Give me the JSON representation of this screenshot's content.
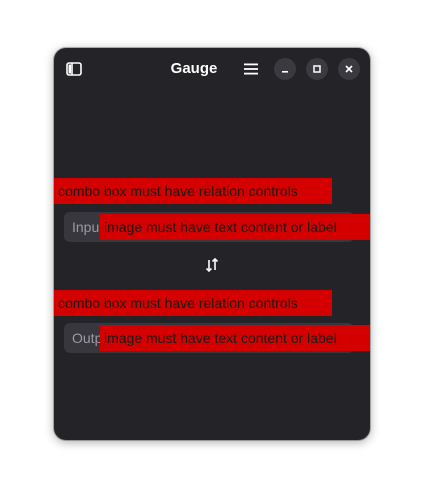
{
  "window": {
    "title": "Gauge"
  },
  "titlebar": {
    "sidebar_icon": "sidebar-toggle-icon",
    "menu_icon": "hamburger-menu-icon",
    "minimize_icon": "minimize-icon",
    "maximize_icon": "maximize-icon",
    "close_icon": "close-icon"
  },
  "input_section": {
    "combo_error": "combo box must have relation controls",
    "field_value": "Inpu",
    "image_error": "image must have text content or label"
  },
  "swap": {
    "icon": "swap-vertical-arrows-icon"
  },
  "output_section": {
    "combo_error": "combo box must have relation controls",
    "field_value": "Outp",
    "image_error": "image must have text content or label"
  },
  "colors": {
    "window_bg": "#232328",
    "field_bg": "#37373d",
    "error_bg": "#d40000",
    "text": "#ffffff"
  }
}
